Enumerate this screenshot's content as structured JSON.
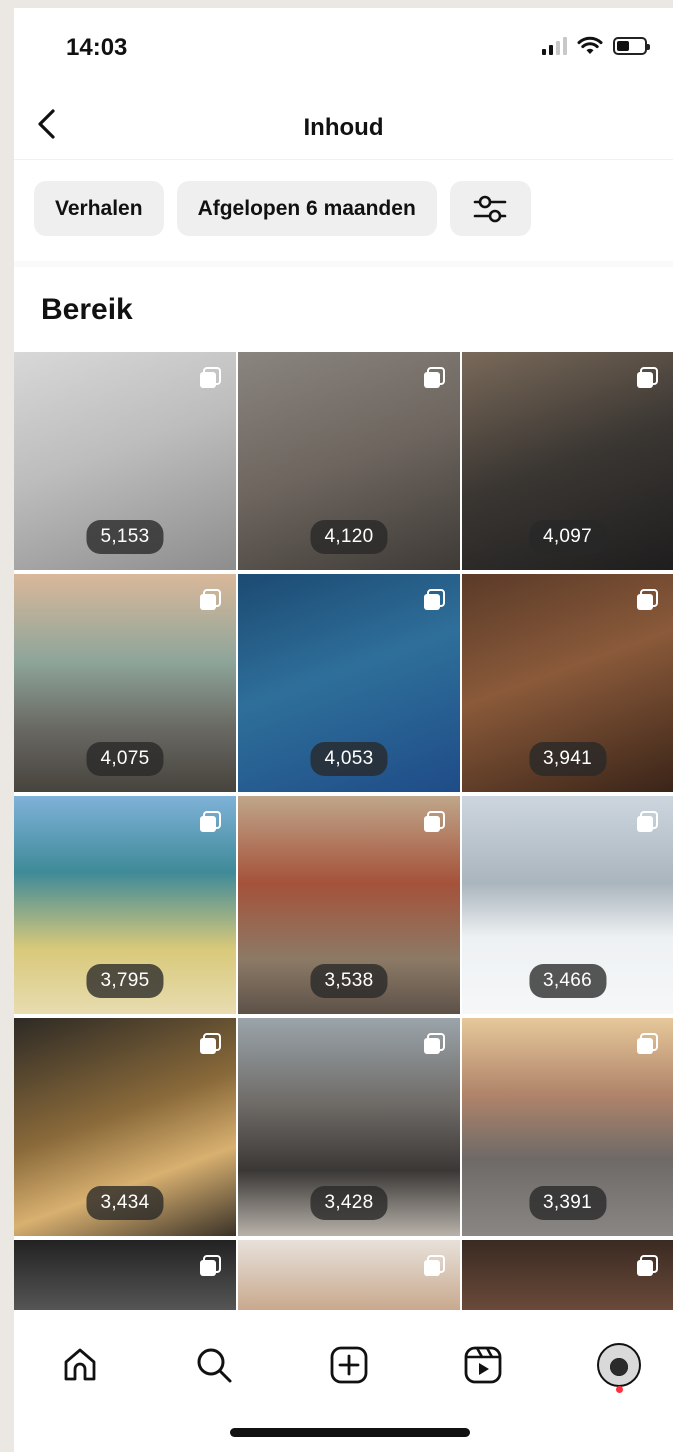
{
  "status_bar": {
    "time": "14:03"
  },
  "header": {
    "title": "Inhoud"
  },
  "filters": [
    {
      "label": "Verhalen"
    },
    {
      "label": "Afgelopen 6 maanden"
    }
  ],
  "section": {
    "title": "Bereik"
  },
  "grid": {
    "tiles": [
      {
        "count": "5,153",
        "bg": "linear-gradient(160deg,#d8d8d8 0%,#bdbdbd 45%,#8d8d8d 100%)"
      },
      {
        "count": "4,120",
        "bg": "linear-gradient(160deg,#8a857f 0%,#6d655e 50%,#3e3a36 100%)"
      },
      {
        "count": "4,097",
        "bg": "linear-gradient(160deg,#7a6a5a 0%,#3a3632 50%,#1e1e1e 100%)"
      },
      {
        "count": "4,075",
        "bg": "linear-gradient(180deg,#d9b89a 0%,#8ea59a 40%,#6a6a64 70%,#47433d 100%)"
      },
      {
        "count": "4,053",
        "bg": "linear-gradient(160deg,#1c4a72 0%,#2e6f9a 45%,#1f4c88 100%)"
      },
      {
        "count": "3,941",
        "bg": "linear-gradient(160deg,#5a3a28 0%,#8a5a3a 45%,#3a2418 100%)"
      },
      {
        "count": "3,795",
        "bg": "linear-gradient(180deg,#7fb2d8 0%,#3f8a98 35%,#d8c97a 70%,#e8dcb0 100%)"
      },
      {
        "count": "3,538",
        "bg": "linear-gradient(180deg,#bfa68a 0%,#a5523a 40%,#8c7a66 75%,#5d5148 100%)"
      },
      {
        "count": "3,466",
        "bg": "linear-gradient(180deg,#cdd6de 0%,#aab5bd 40%,#eef1f3 65%,#f5f7f8 100%)"
      },
      {
        "count": "3,434",
        "bg": "linear-gradient(160deg,#2d2a25 0%,#8a6a3a 45%,#d8b070 70%,#3a3228 100%)"
      },
      {
        "count": "3,428",
        "bg": "linear-gradient(180deg,#9aa4aa 0%,#6e6a66 40%,#3a3836 70%,#b8b2aa 100%)"
      },
      {
        "count": "3,391",
        "bg": "linear-gradient(180deg,#e6c89a 0%,#b0846a 35%,#6e6a68 65%,#8a8684 100%)"
      },
      {
        "count": "",
        "bg": "linear-gradient(180deg,#222 0%,#555 100%)"
      },
      {
        "count": "",
        "bg": "linear-gradient(180deg,#e7e1da 0%,#c9a98e 100%)"
      },
      {
        "count": "",
        "bg": "linear-gradient(180deg,#3a2a22 0%,#6a4a3a 100%)"
      }
    ]
  },
  "colors": {
    "chip_bg": "#efefef",
    "text": "#111111",
    "notification": "#ff3040"
  }
}
